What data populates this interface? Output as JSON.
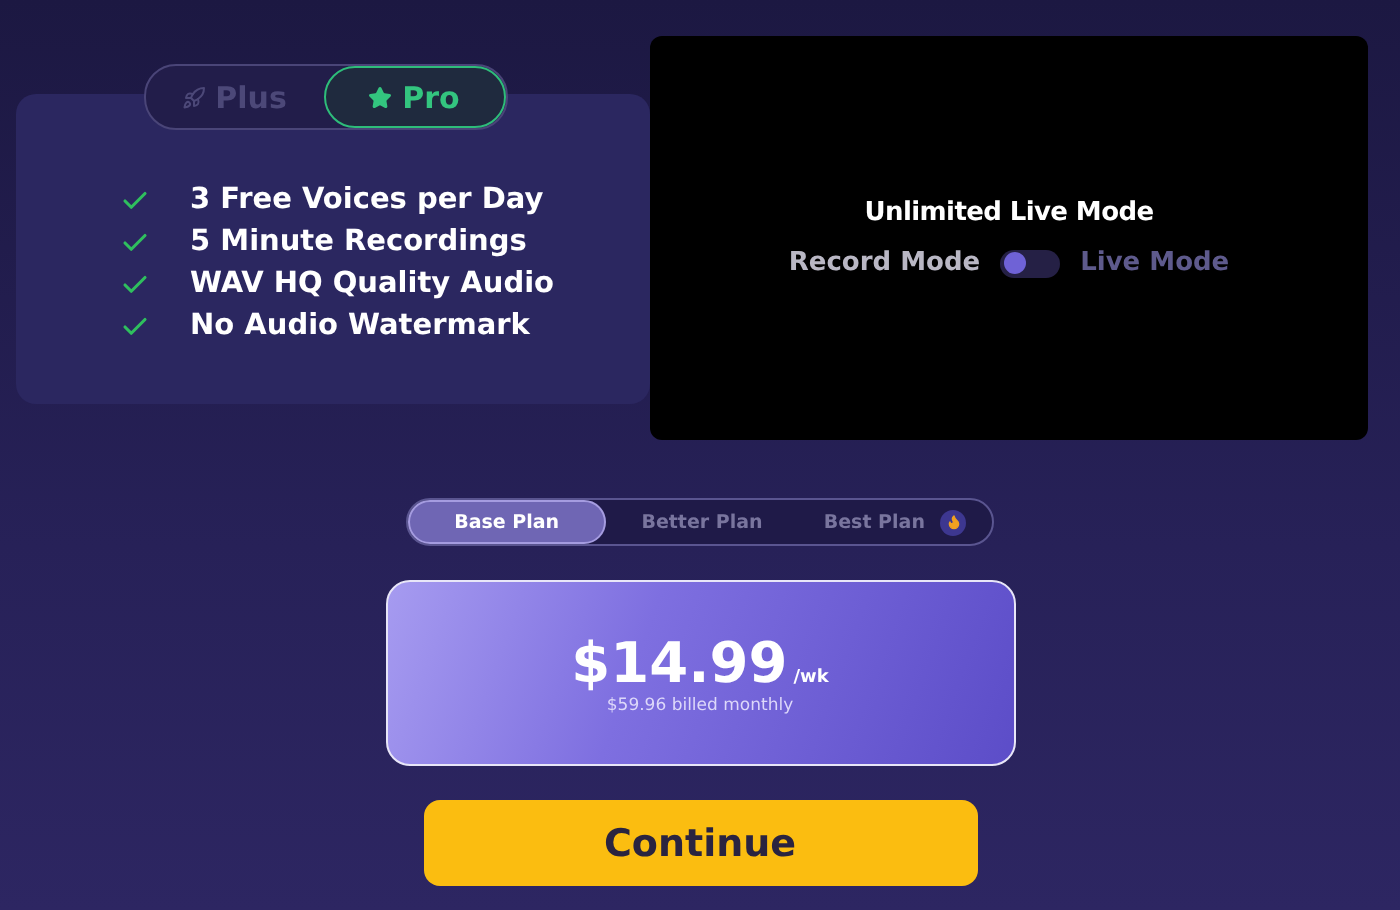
{
  "plan_toggle": [
    {
      "label": "Plus",
      "selected": false
    },
    {
      "label": "Pro",
      "selected": true
    }
  ],
  "features": [
    "3 Free Voices per Day",
    "5 Minute Recordings",
    "WAV HQ Quality Audio",
    "No Audio Watermark"
  ],
  "preview": {
    "title": "Unlimited Live Mode",
    "left_label": "Record Mode",
    "right_label": "Live Mode",
    "on": false
  },
  "plan_tabs": [
    {
      "label": "Base Plan",
      "selected": true,
      "hot": false
    },
    {
      "label": "Better Plan",
      "selected": false,
      "hot": false
    },
    {
      "label": "Best Plan",
      "selected": false,
      "hot": true
    }
  ],
  "price": {
    "amount": "$14.99",
    "unit": "/wk",
    "billing": "$59.96 billed monthly"
  },
  "continue_button": "Continue"
}
